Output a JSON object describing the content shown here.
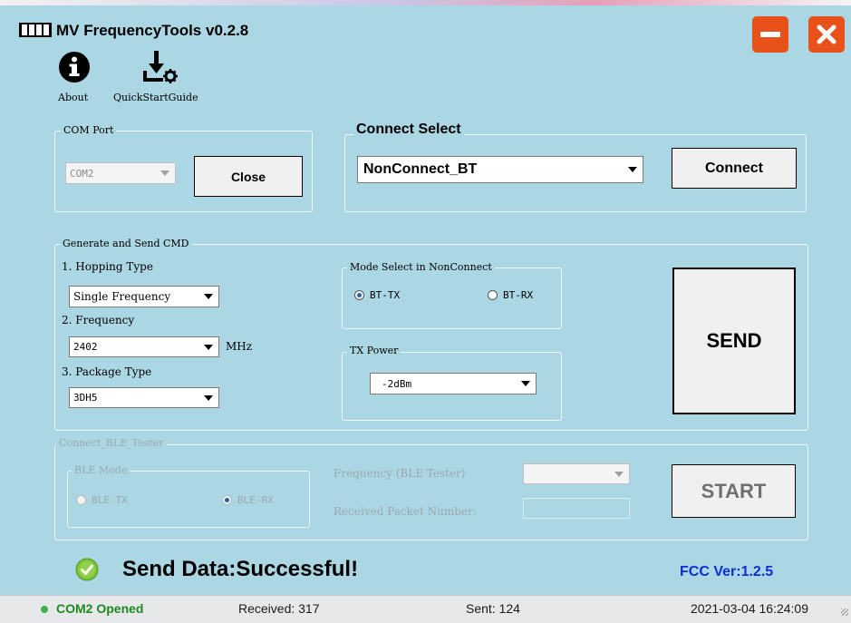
{
  "app": {
    "title": "MV FrequencyTools v0.2.8"
  },
  "toolbar": {
    "about_label": "About",
    "quickstart_label": "QuickStartGuide"
  },
  "com_port": {
    "legend": "COM Port",
    "selected": "COM2",
    "close_label": "Close"
  },
  "connect_select": {
    "legend": "Connect Select",
    "selected": "NonConnect_BT",
    "connect_label": "Connect"
  },
  "generate": {
    "legend": "Generate and Send CMD",
    "hopping_label": "1. Hopping Type",
    "hopping_value": "Single Frequency",
    "frequency_label": "2. Frequency",
    "frequency_value": "2402",
    "frequency_unit": "MHz",
    "package_label": "3. Package Type",
    "package_value": "3DH5",
    "mode_legend": "Mode Select in NonConnect",
    "mode_tx": "BT-TX",
    "mode_rx": "BT-RX",
    "mode_selected": "BT-TX",
    "txpower_legend": "TX Power",
    "txpower_value": "-2dBm",
    "send_label": "SEND"
  },
  "ble": {
    "legend": "Connect_BLE_Tester",
    "mode_legend": "BLE Mode",
    "tx_label": "BLE-TX",
    "rx_label": "BLE-RX",
    "selected": "BLE-RX",
    "frequency_label": "Frequency (BLE Tester)",
    "frequency_value": "",
    "received_label": "Received Packet Number:",
    "received_value": "",
    "start_label": "START"
  },
  "result": {
    "message": "Send Data:Successful!",
    "fcc_version": "FCC Ver:1.2.5"
  },
  "status": {
    "port": "COM2 Opened",
    "received": "Received: 317",
    "sent": "Sent: 124",
    "datetime": "2021-03-04 16:24:09"
  },
  "colors": {
    "background": "#abd6e3",
    "window_button": "#e8511a",
    "success_green": "#7cc13a",
    "fcc_blue": "#0b2fd6",
    "status_green": "#1e8a1e"
  },
  "icons": {
    "about": "info-circle-icon",
    "quickstart": "download-gear-icon",
    "minimize": "minimize-icon",
    "close": "close-icon",
    "success": "checkmark-circle-icon",
    "status": "status-dot-icon"
  }
}
